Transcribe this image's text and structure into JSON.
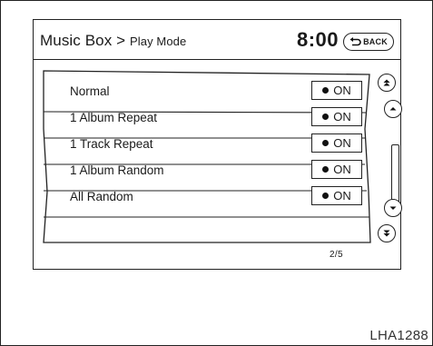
{
  "header": {
    "title": "Music Box",
    "separator": ">",
    "subtitle": "Play Mode",
    "time": "8:00",
    "back_label": "BACK"
  },
  "list": {
    "items": [
      {
        "label": "Normal",
        "state": "ON"
      },
      {
        "label": "1 Album Repeat",
        "state": "ON"
      },
      {
        "label": "1 Track Repeat",
        "state": "ON"
      },
      {
        "label": "1 Album Random",
        "state": "ON"
      },
      {
        "label": "All Random",
        "state": "ON"
      }
    ],
    "page_indicator": "2/5"
  },
  "icons": {
    "back": "u-turn-arrow-icon",
    "page_up": "double-chevron-up-icon",
    "scroll_up": "chevron-up-icon",
    "scroll_down": "chevron-down-icon",
    "page_down": "double-chevron-down-icon"
  },
  "caption": "LHA1288"
}
